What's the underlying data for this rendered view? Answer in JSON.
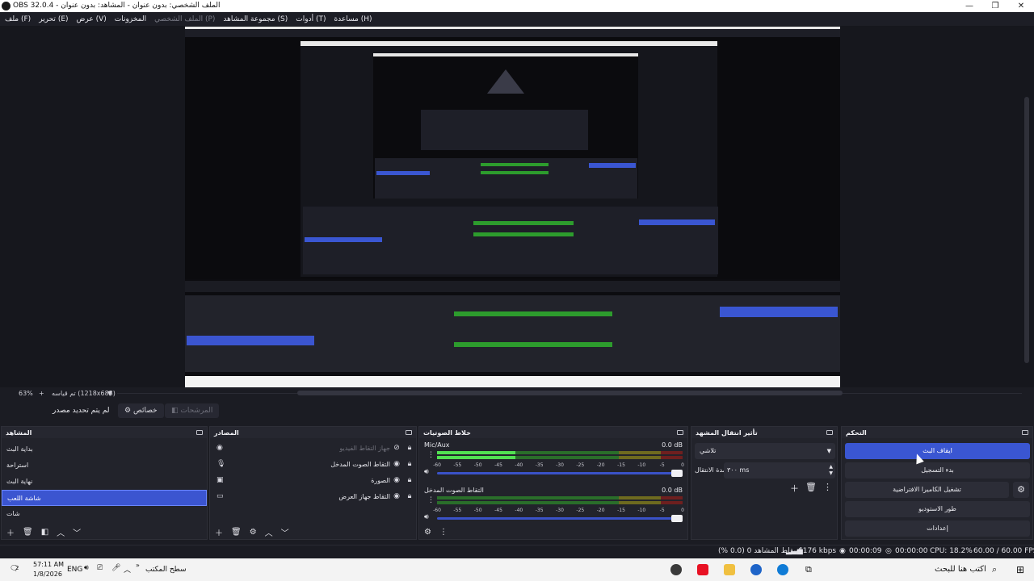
{
  "window": {
    "title": "OBS 32.0.4 - الملف الشخصي: بدون عنوان - المشاهد: بدون عنوان",
    "minimize": "—",
    "restore": "❐",
    "close": "✕"
  },
  "menu": [
    "ملف (F)",
    "تحرير (E)",
    "عرض (V)",
    "المخزونات",
    "الملف الشخصي (P)",
    "مجموعة المشاهد (S)",
    "أدوات (T)",
    "مساعدة (H)"
  ],
  "preview": {
    "label": "preview-canvas-with-nested-obs-capture"
  },
  "zoombar": {
    "zoom": "63%",
    "plus": "+",
    "resolution": "تم قياسه (1218x685)",
    "dropdown": "▼"
  },
  "controls_row": {
    "no_source": "لم يتم تحديد مصدر",
    "properties": "خصائص",
    "filters": "المرشحات"
  },
  "scenes": {
    "title": "المشاهد",
    "items": [
      "بداية البث",
      "استراحة",
      "نهاية البث",
      "شاشة اللعب",
      "شات"
    ],
    "selected": 3
  },
  "sources": {
    "title": "المصادر",
    "items": [
      {
        "name": "جهاز التقاط الفيديو",
        "icon": "camera-icon",
        "hidden": true
      },
      {
        "name": "التقاط الصوت المدخل",
        "icon": "mic-icon",
        "hidden": false
      },
      {
        "name": "الصورة",
        "icon": "image-icon",
        "hidden": false
      },
      {
        "name": "التقاط جهاز العرض",
        "icon": "monitor-icon",
        "hidden": false
      }
    ]
  },
  "mixer": {
    "title": "خلاط الصوتيات",
    "channels": [
      {
        "name": "Mic/Aux",
        "db": "0.0 dB",
        "level": 0.32
      },
      {
        "name": "التقاط الصوت المدخل",
        "db": "0.0 dB",
        "level": 0.0
      }
    ],
    "ticks": [
      "-60",
      "-55",
      "-50",
      "-45",
      "-40",
      "-35",
      "-30",
      "-25",
      "-20",
      "-15",
      "-10",
      "-5",
      "0"
    ]
  },
  "chart_data": {
    "type": "bar",
    "title": "",
    "categories": [
      "Mic/Aux",
      "التقاط الصوت المدخل"
    ],
    "values": [
      0.0,
      0.0
    ],
    "value_labels": [
      "0.0 dB",
      "0.0 dB"
    ],
    "xlabel": "",
    "ylabel": "",
    "ylim": [
      -60,
      0
    ],
    "ticks": [
      -60,
      -55,
      -50,
      -45,
      -40,
      -35,
      -30,
      -25,
      -20,
      -15,
      -10,
      -5,
      0
    ]
  },
  "transitions": {
    "title": "تأثير انتقال المشهد",
    "selected": "تلاشي",
    "duration_label": "مدة الانتقال",
    "duration_value": "٣٠٠ ms"
  },
  "controls": {
    "title": "التحكم",
    "stop_stream": "ايقاف البث",
    "start_recording": "بدء التسجيل",
    "virtual_camera": "تشغيل الكاميرا الافتراضية",
    "studio_mode": "طور الاستوديو",
    "settings": "إعدادات"
  },
  "status": {
    "fps": "60.00 / 60.00 FPS",
    "cpu": "CPU: 18.2%",
    "rec_time": "00:00:00",
    "stream_time": "00:00:09",
    "bitrate": "6176 kbps",
    "dropped": "إسقاط المشاهد 0 (0.0 %)"
  },
  "taskbar": {
    "search_placeholder": "اكتب هنا للبحث",
    "desktop": "سطح المكتب",
    "time": "57:11 AM",
    "date": "1/8/2026",
    "lang": "ENG",
    "notif": "2"
  },
  "colors": {
    "accent": "#3a56d2",
    "meter_green": "#52e052",
    "background": "#1b1c23"
  }
}
